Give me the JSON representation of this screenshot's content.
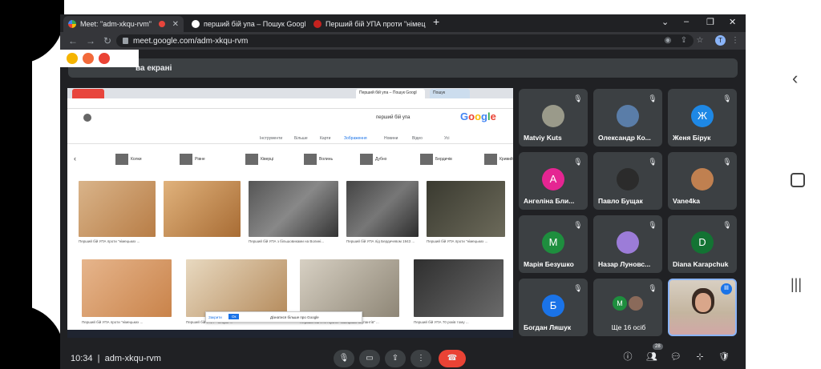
{
  "tabs": [
    {
      "label": "Meet: \"adm-xkqu-rvm\"",
      "active": true
    },
    {
      "label": "перший бій упа – Пошук Googl",
      "active": false
    },
    {
      "label": "Перший бій УПА проти \"німец",
      "active": false
    }
  ],
  "new_tab": "+",
  "window_controls": [
    "⌄",
    "–",
    "❐",
    "✕"
  ],
  "address": "meet.google.com/adm-xkqu-rvm",
  "banner_text": "ва екрані",
  "shared": {
    "tab1": "Перший бій упа – Пошук Googl",
    "tab2": "Пошук",
    "search_query": "перший бій упа",
    "nav_items": [
      "Усі",
      "Відео",
      "Зображення",
      "Новини",
      "Карти",
      "Більше",
      "Інструменти"
    ],
    "chips": [
      "Кривий",
      "Бердичів",
      "Дубно",
      "Волинь",
      "Ківерці",
      "Рівне",
      "Колки"
    ],
    "captions_row1": [
      "Перший бій УПА проти \"німецьких ...",
      "Перший бій УПА з більшовиками на Волині...",
      "Перший бій УПА під Бердичевом 1943 ...",
      "Перший бій УПА проти \"німецьких ..."
    ],
    "captions_row2": [
      "Перший бій УПА проти \"німецьких ...",
      "Перший бій УПА – історія ...",
      "Перший бій УПА проти \"німецьких окупантів\" ...",
      "Перший бій УПА 70 років тому ..."
    ],
    "popup_text": "Дізнатися більше про Google",
    "popup_btn1": "Закрити",
    "popup_btn2": "Ок"
  },
  "participants": [
    {
      "name": "Matviy Kuts",
      "initial": "",
      "color": "#8a8a8a",
      "muted": true
    },
    {
      "name": "Олександр Ко...",
      "initial": "",
      "color": "#5a7da8",
      "muted": true
    },
    {
      "name": "Женя Бірук",
      "initial": "Ж",
      "color": "#1e88e5",
      "muted": true
    },
    {
      "name": "Ангеліна Бли...",
      "initial": "А",
      "color": "#e52592",
      "muted": true
    },
    {
      "name": "Павло Бущак",
      "initial": "",
      "color": "#2b2b2b",
      "muted": true
    },
    {
      "name": "Vane4ka",
      "initial": "",
      "color": "#c08050",
      "muted": true
    },
    {
      "name": "Марія Безушко",
      "initial": "М",
      "color": "#1e8e3e",
      "muted": true
    },
    {
      "name": "Назар Луновс...",
      "initial": "",
      "color": "#9c7cd8",
      "muted": true
    },
    {
      "name": "Diana Karapchuk",
      "initial": "D",
      "color": "#137333",
      "muted": true
    },
    {
      "name": "Богдан Ляшук",
      "initial": "Б",
      "color": "#1a73e8",
      "muted": true
    },
    {
      "name": "Ще 16 осіб",
      "initial": "М",
      "color": "#1e8e3e",
      "muted": false
    }
  ],
  "meeting_time": "10:34",
  "meeting_code": "adm-xkqu-rvm",
  "people_count": "28",
  "colors": {
    "accent": "#8ab4f8",
    "hangup": "#ea4335",
    "bg": "#202124",
    "tile": "#3c4043"
  }
}
